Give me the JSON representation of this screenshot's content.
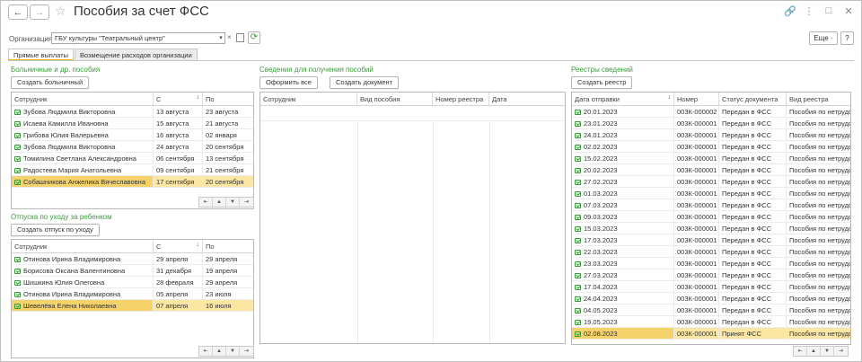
{
  "header": {
    "title": "Пособия за счет ФСС",
    "back_glyph": "←",
    "forward_glyph": "→",
    "star_glyph": "☆",
    "link_glyph": "🔗",
    "menu_glyph": "⋮",
    "maximize_glyph": "□",
    "close_glyph": "✕"
  },
  "org": {
    "label": "Организация:",
    "value": "ГБУ культуры \"Театральный центр\"",
    "dropdown_glyph": "▾",
    "clear_glyph": "×",
    "open_glyph": "⧉",
    "refresh_glyph": "⟳"
  },
  "toolbar": {
    "more_label": "Еще ·",
    "help_label": "?"
  },
  "tabs": [
    {
      "label": "Прямые выплаты",
      "active": true
    },
    {
      "label": "Возмещение расходов организации",
      "active": false
    }
  ],
  "sick": {
    "title": "Больничные и др. пособия",
    "create_label": "Создать больничный",
    "columns": [
      "Сотрудник",
      "С",
      "По"
    ],
    "sort_glyph": "↓",
    "rows": [
      [
        "Зубова Людмила Викторовна",
        "13 августа",
        "23 августа"
      ],
      [
        "Исаева Камилла Ивановна",
        "15 августа",
        "21 августа"
      ],
      [
        "Грибова Юлия Валерьевна",
        "16 августа",
        "02 января"
      ],
      [
        "Зубова Людмила Викторовна",
        "24 августа",
        "20 сентября"
      ],
      [
        "Томилина Светлана Александровна",
        "06 сентября",
        "13 сентября"
      ],
      [
        "Радостева Мария Анатольевна",
        "09 сентября",
        "21 сентября"
      ],
      [
        "Собашникова Анжелика Вячеславовна",
        "17 сентября",
        "20 сентября"
      ]
    ],
    "selected": 6
  },
  "vacation": {
    "title": "Отпуска по уходу за ребенком",
    "create_label": "Создать отпуск по уходу",
    "columns": [
      "Сотрудник",
      "С",
      "По"
    ],
    "sort_glyph": "↓",
    "rows": [
      [
        "Отинова Ирина Владимировна",
        "29 апреля",
        "29 апреля"
      ],
      [
        "Борисова Оксана Валентиновна",
        "31 декабря",
        "19 апреля"
      ],
      [
        "Шишкина Юлия Олеговна",
        "28 февраля",
        "29 апреля"
      ],
      [
        "Отинова Ирина Владимировна",
        "05 апреля",
        "23 июля"
      ],
      [
        "Шевелёва Елена Николаевна",
        "07 апреля",
        "16 июля"
      ]
    ],
    "selected": 4
  },
  "info": {
    "title": "Сведения для получения пособий",
    "send_all_label": "Оформить все",
    "create_doc_label": "Создать документ",
    "columns": [
      "Сотрудник",
      "Вид пособия",
      "Номер реестра",
      "Дата"
    ]
  },
  "registers": {
    "title": "Реестры сведений",
    "create_label": "Создать реестр",
    "columns": [
      "Дата отправки",
      "Номер",
      "Статус документа",
      "Вид реестра"
    ],
    "sort_glyph": "↓",
    "rows": [
      [
        "20.01.2023",
        "003К-000002",
        "Передан в ФСС",
        "Пособия по нетрудо..."
      ],
      [
        "23.01.2023",
        "003К-000001",
        "Передан в ФСС",
        "Пособия по нетрудо..."
      ],
      [
        "24.01.2023",
        "003К-000001",
        "Передан в ФСС",
        "Пособия по нетрудо..."
      ],
      [
        "02.02.2023",
        "003К-000001",
        "Передан в ФСС",
        "Пособия по нетрудо..."
      ],
      [
        "15.02.2023",
        "003К-000001",
        "Передан в ФСС",
        "Пособия по нетрудо..."
      ],
      [
        "20.02.2023",
        "003К-000001",
        "Передан в ФСС",
        "Пособия по нетрудо..."
      ],
      [
        "27.02.2023",
        "003К-000001",
        "Передан в ФСС",
        "Пособия по нетрудо..."
      ],
      [
        "01.03.2023",
        "003К-000001",
        "Передан в ФСС",
        "Пособия по нетрудо..."
      ],
      [
        "07.03.2023",
        "003К-000001",
        "Передан в ФСС",
        "Пособия по нетрудо..."
      ],
      [
        "09.03.2023",
        "003К-000001",
        "Передан в ФСС",
        "Пособия по нетрудо..."
      ],
      [
        "15.03.2023",
        "003К-000001",
        "Передан в ФСС",
        "Пособия по нетрудо..."
      ],
      [
        "17.03.2023",
        "003К-000001",
        "Передан в ФСС",
        "Пособия по нетрудо..."
      ],
      [
        "22.03.2023",
        "003К-000001",
        "Передан в ФСС",
        "Пособия по нетрудо..."
      ],
      [
        "23.03.2023",
        "003К-000001",
        "Передан в ФСС",
        "Пособия по нетрудо..."
      ],
      [
        "27.03.2023",
        "003К-000001",
        "Передан в ФСС",
        "Пособия по нетрудо..."
      ],
      [
        "17.04.2023",
        "003К-000001",
        "Передан в ФСС",
        "Пособия по нетрудо..."
      ],
      [
        "24.04.2023",
        "003К-000001",
        "Передан в ФСС",
        "Пособия по нетрудо..."
      ],
      [
        "04.05.2023",
        "003К-000001",
        "Передан в ФСС",
        "Пособия по нетрудо..."
      ],
      [
        "19.05.2023",
        "003К-000001",
        "Передан в ФСС",
        "Пособия по нетрудо..."
      ],
      [
        "02.08.2023",
        "003К-000001",
        "Принят ФСС",
        "Пособия по нетрудо..."
      ]
    ],
    "selected": 19
  },
  "pager": [
    "⇤",
    "▲",
    "▼",
    "⇥"
  ],
  "colors": {
    "accent_green": "#3d9a3d",
    "selected_row": "#fbe6a3",
    "selected_cell": "#f6d36a",
    "tab_underline": "#f5b400"
  }
}
